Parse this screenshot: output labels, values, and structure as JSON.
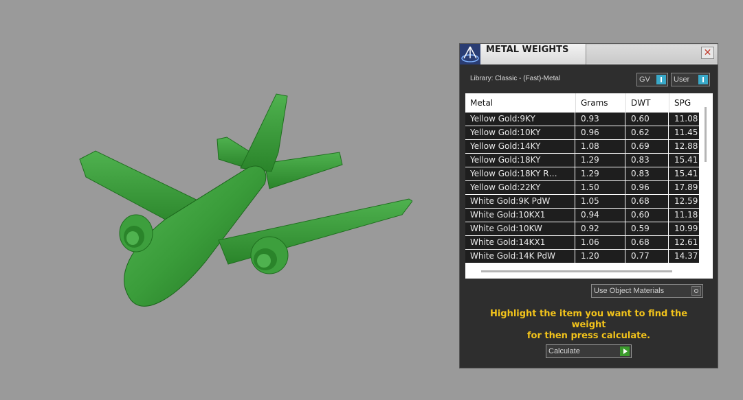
{
  "panel": {
    "title": "METAL WEIGHTS",
    "close_symbol": "✕",
    "library_label": "Library: Classic - (Fast)-Metal",
    "toggle_gv": "GV",
    "toggle_user": "User",
    "columns": [
      "Metal",
      "Grams",
      "DWT",
      "SPG"
    ],
    "rows": [
      {
        "metal": "Yellow Gold:9KY",
        "grams": "0.93",
        "dwt": "0.60",
        "spg": "11.08"
      },
      {
        "metal": "Yellow Gold:10KY",
        "grams": "0.96",
        "dwt": "0.62",
        "spg": "11.45"
      },
      {
        "metal": "Yellow Gold:14KY",
        "grams": "1.08",
        "dwt": "0.69",
        "spg": "12.88"
      },
      {
        "metal": "Yellow Gold:18KY",
        "grams": "1.29",
        "dwt": "0.83",
        "spg": "15.41"
      },
      {
        "metal": "Yellow Gold:18KY R…",
        "grams": "1.29",
        "dwt": "0.83",
        "spg": "15.41"
      },
      {
        "metal": "Yellow Gold:22KY",
        "grams": "1.50",
        "dwt": "0.96",
        "spg": "17.89"
      },
      {
        "metal": "White Gold:9K PdW",
        "grams": "1.05",
        "dwt": "0.68",
        "spg": "12.59"
      },
      {
        "metal": "White Gold:10KX1",
        "grams": "0.94",
        "dwt": "0.60",
        "spg": "11.18"
      },
      {
        "metal": "White Gold:10KW",
        "grams": "0.92",
        "dwt": "0.59",
        "spg": "10.99"
      },
      {
        "metal": "White Gold:14KX1",
        "grams": "1.06",
        "dwt": "0.68",
        "spg": "12.61"
      },
      {
        "metal": "White Gold:14K PdW",
        "grams": "1.20",
        "dwt": "0.77",
        "spg": "14.37"
      }
    ],
    "use_object_materials": "Use Object Materials",
    "instructions_line1": "Highlight the item you want to find the weight",
    "instructions_line2": "for then press calculate.",
    "calculate_label": "Calculate"
  },
  "colors": {
    "viewport_background": "#9a9a9a",
    "model_green": "#3b9e3b",
    "panel_background": "#2e2e2e",
    "instruction_yellow": "#f2c31b",
    "toggle_accent": "#39a9c9",
    "calculate_accent": "#3b9b2c"
  }
}
